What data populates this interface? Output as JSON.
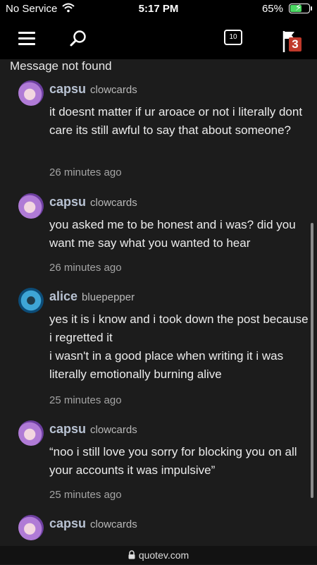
{
  "status_bar": {
    "carrier": "No Service",
    "time": "5:17 PM",
    "battery_percent": "65%",
    "battery_level": 0.65
  },
  "nav": {
    "notification_count": "10",
    "flag_badge": "3"
  },
  "message_not_found": "Message not found",
  "comments": [
    {
      "username": "capsu",
      "handle": "clowcards",
      "lines": [
        "it doesnt matter if ur aroace or not i literally dont care its still awful to say that about someone?"
      ],
      "timestamp": "26 minutes ago",
      "avatar": "purple-haired-avatar"
    },
    {
      "username": "capsu",
      "handle": "clowcards",
      "lines": [
        "you asked me to be honest and i was? did you want me say what you wanted to hear"
      ],
      "timestamp": "26 minutes ago",
      "avatar": "purple-haired-avatar"
    },
    {
      "username": "alice",
      "handle": "bluepepper",
      "lines": [
        "yes it is i know and i took down the post because i regretted it",
        "i wasn't in a good place when writing it i was literally emotionally burning alive"
      ],
      "timestamp": "25 minutes ago",
      "avatar": "blue-avatar"
    },
    {
      "username": "capsu",
      "handle": "clowcards",
      "lines": [
        "“noo i still love you sorry for blocking you on all your accounts it was impulsive”"
      ],
      "timestamp": "25 minutes ago",
      "avatar": "purple-haired-avatar"
    },
    {
      "username": "capsu",
      "handle": "clowcards",
      "lines": [],
      "timestamp": "",
      "avatar": "purple-haired-avatar"
    }
  ],
  "url_bar": {
    "domain": "quotev.com"
  },
  "icons": {
    "menu": "hamburger-icon",
    "search": "search-icon",
    "notifications": "notifications-icon",
    "flag": "flag-icon",
    "lock": "lock-icon",
    "wifi": "wifi-icon"
  },
  "colors": {
    "background": "#1c1c1c",
    "badge": "#c0392b",
    "username": "#b8c2d2"
  }
}
